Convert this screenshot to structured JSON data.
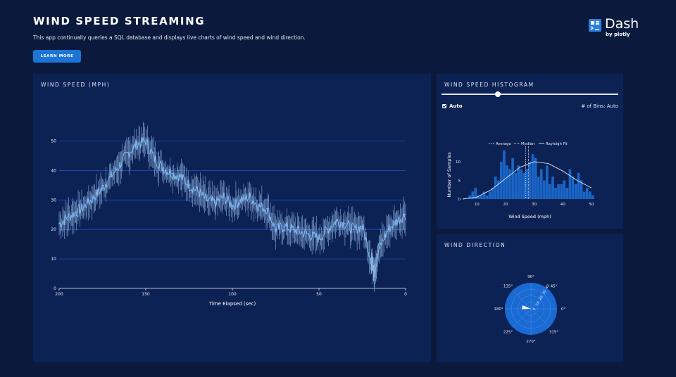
{
  "header": {
    "title": "WIND SPEED STREAMING",
    "description": "This app continually queries a SQL database and displays live charts of wind speed and wind direction.",
    "learn_more_label": "LEARN MORE"
  },
  "logo": {
    "word": "Dash",
    "by": "by plotly"
  },
  "speed_panel": {
    "title": "WIND SPEED (MPH)"
  },
  "hist_panel": {
    "title": "WIND SPEED HISTOGRAM",
    "auto_label": "Auto",
    "bins_label": "# of Bins: Auto",
    "slider_value": 0.32
  },
  "dir_panel": {
    "title": "WIND DIRECTION"
  },
  "colors": {
    "background": "#0b1a3c",
    "panel": "#0d2254",
    "accent": "#1c74d6",
    "line": "#7fb4ee",
    "bar": "#1a65c7"
  },
  "chart_data": [
    {
      "type": "line",
      "title": "WIND SPEED (MPH)",
      "xlabel": "Time Elapsed (sec)",
      "ylabel": "",
      "xlim": [
        200,
        0
      ],
      "ylim": [
        0,
        58
      ],
      "xticks": [
        "200",
        "150",
        "100",
        "50",
        "0"
      ],
      "yticks": [
        "0",
        "10",
        "20",
        "30",
        "40",
        "50"
      ],
      "error_bar_halfwidth": 4,
      "series": [
        {
          "x": [
            200,
            195,
            190,
            185,
            180,
            175,
            170,
            165,
            160,
            155,
            150,
            145,
            140,
            135,
            130,
            125,
            120,
            115,
            110,
            105,
            100,
            95,
            90,
            85,
            80,
            75,
            70,
            65,
            60,
            55,
            50,
            45,
            40,
            35,
            30,
            25,
            20,
            18,
            15,
            10,
            5,
            0
          ],
          "values": [
            22,
            24,
            26,
            28,
            31,
            34,
            38,
            42,
            46,
            49,
            50,
            44,
            41,
            39,
            38,
            35,
            33,
            30,
            29,
            31,
            28,
            30,
            31,
            28,
            27,
            20,
            21,
            20,
            19,
            18,
            17,
            20,
            23,
            22,
            20,
            21,
            10,
            6,
            14,
            20,
            23,
            25
          ]
        }
      ]
    },
    {
      "type": "bar",
      "title": "WIND SPEED HISTOGRAM",
      "xlabel": "Wind Speed (mph)",
      "ylabel": "Number of Samples",
      "xlim": [
        5,
        52
      ],
      "ylim": [
        0,
        13
      ],
      "xticks": [
        "10",
        "20",
        "30",
        "40",
        "50"
      ],
      "yticks": [
        "0",
        "5",
        "10"
      ],
      "legend": [
        "Average",
        "Median",
        "Rayleigh Fit"
      ],
      "legend_position": "top",
      "average": 27,
      "median": 28,
      "bin_width": 1,
      "bins": [
        7,
        8,
        9,
        10,
        11,
        12,
        13,
        14,
        15,
        16,
        17,
        18,
        19,
        20,
        21,
        22,
        23,
        24,
        25,
        26,
        27,
        28,
        29,
        30,
        31,
        32,
        33,
        34,
        35,
        36,
        37,
        38,
        39,
        40,
        41,
        42,
        43,
        44,
        45,
        46,
        47,
        48,
        49,
        50
      ],
      "values": [
        1,
        2,
        3,
        1,
        1,
        2,
        1,
        2,
        3,
        6,
        5,
        10,
        13,
        9,
        8,
        11,
        7,
        9,
        8,
        7,
        8,
        10,
        12,
        11,
        6,
        8,
        5,
        9,
        4,
        6,
        3,
        4,
        4,
        5,
        3,
        8,
        6,
        4,
        7,
        5,
        2,
        3,
        2,
        1
      ],
      "fit": [
        [
          5,
          0
        ],
        [
          10,
          0.5
        ],
        [
          15,
          2.5
        ],
        [
          20,
          5.5
        ],
        [
          25,
          8.5
        ],
        [
          30,
          10
        ],
        [
          35,
          9.5
        ],
        [
          40,
          7.5
        ],
        [
          45,
          5
        ],
        [
          50,
          3
        ]
      ]
    },
    {
      "type": "polar",
      "title": "WIND DIRECTION",
      "angular_ticks": [
        "90°",
        "45°",
        "0°",
        "315°",
        "270°",
        "225°",
        "180°",
        "135°"
      ],
      "radial_ticks": [
        "0",
        "10",
        "20",
        "30",
        "40"
      ],
      "radial_range": [
        0,
        40
      ],
      "direction_deg": 170,
      "magnitude": 14
    }
  ]
}
